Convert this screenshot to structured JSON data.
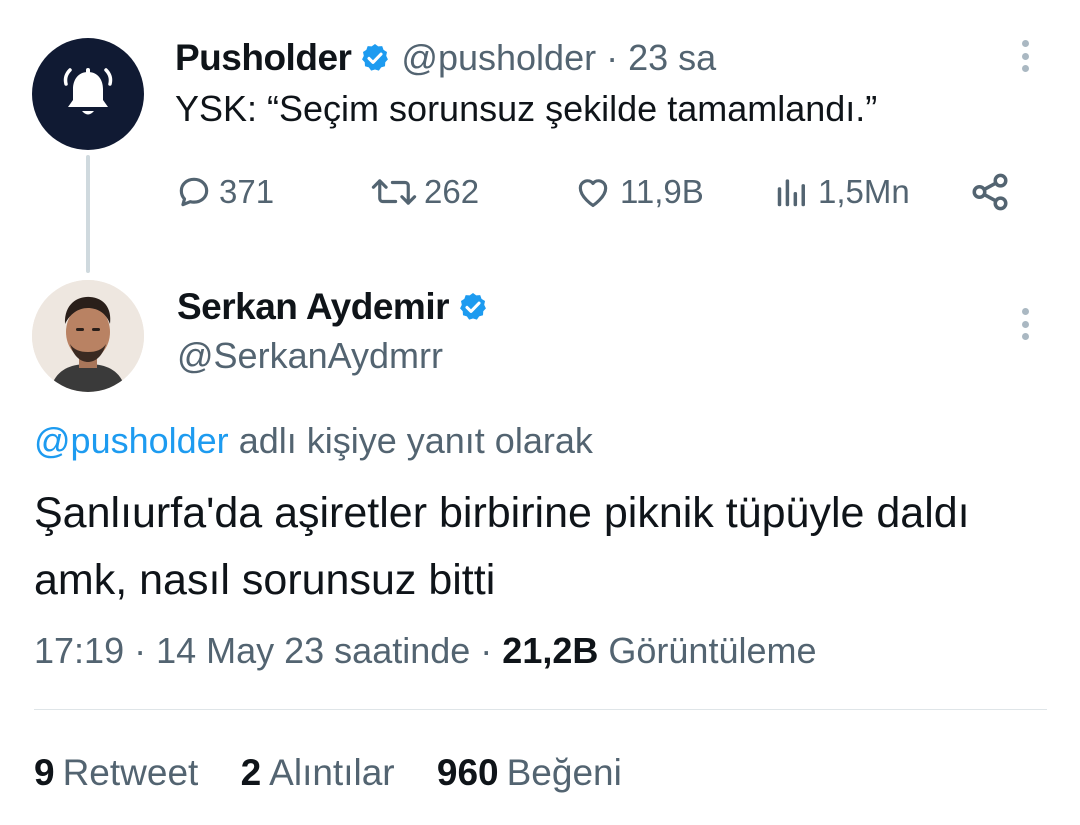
{
  "parent_tweet": {
    "display_name": "Pusholder",
    "handle": "@pusholder",
    "separator": "·",
    "time_ago": "23 sa",
    "text": "YSK: “Seçim sorunsuz şekilde tamamlandı.”",
    "avatar_icon": "bell-ringing-icon",
    "actions": {
      "replies": "371",
      "retweets": "262",
      "likes": "11,9B",
      "views": "1,5Mn"
    }
  },
  "reply_tweet": {
    "display_name": "Serkan Aydemir",
    "handle": "@SerkanAydmrr",
    "reply_mention": "@pusholder",
    "reply_suffix": "adlı kişiye yanıt olarak",
    "text": "Şanlıurfa'da aşiretler birbirine piknik tüpüyle daldı amk, nasıl sorunsuz bitti",
    "timestamp": "17:19 · 14 May 23 saatinde ·",
    "view_count": "21,2B",
    "view_label": "Görüntüleme",
    "stats": {
      "retweets_count": "9",
      "retweets_label": "Retweet",
      "quotes_count": "2",
      "quotes_label": "Alıntılar",
      "likes_count": "960",
      "likes_label": "Beğeni"
    }
  },
  "colors": {
    "text_primary": "#0f1419",
    "text_secondary": "#536471",
    "link_blue": "#1d9bf0",
    "verified_blue": "#1d9bf0",
    "bell_avatar_bg": "#101a33"
  }
}
